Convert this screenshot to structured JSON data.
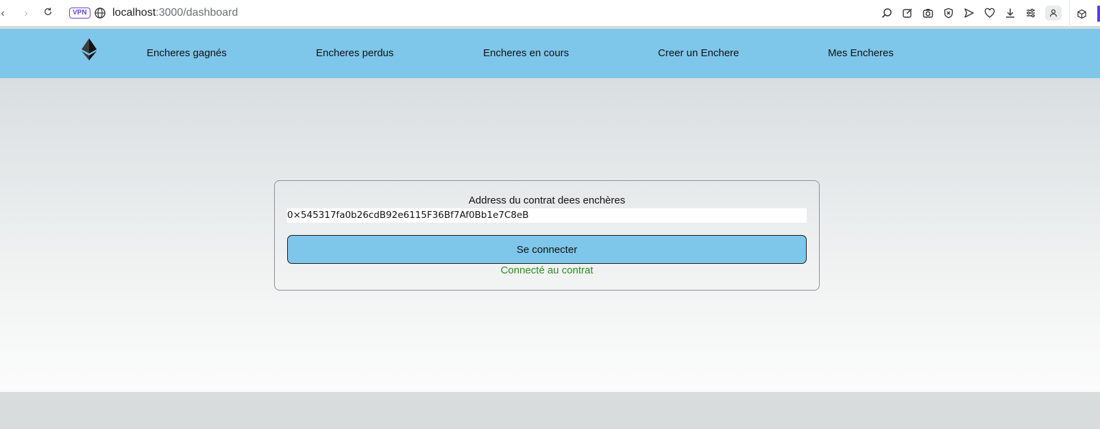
{
  "browser": {
    "vpn_label": "VPN",
    "url_host": "localhost",
    "url_path": ":3000/dashboard",
    "icons": [
      "back-icon",
      "forward-icon",
      "reload-icon",
      "globe-icon",
      "search-icon",
      "edit-icon",
      "camera-icon",
      "shield-icon",
      "send-icon",
      "heart-icon",
      "download-icon",
      "settings-icon",
      "profile-icon",
      "extension-icon"
    ]
  },
  "navbar": {
    "logo_icon": "ethereum-icon",
    "links": [
      "Encheres gagnés",
      "Encheres perdus",
      "Encheres en cours",
      "Creer un Enchere",
      "Mes Encheres"
    ]
  },
  "card": {
    "label": "Address du contrat dees enchères",
    "address_value": "0×545317fa0b26cdB92e6115F36Bf7Af0Bb1e7C8eB",
    "button_label": "Se connecter",
    "status_text": "Connecté au contrat"
  },
  "colors": {
    "navbar_bg": "#7ec6ea",
    "button_bg": "#7ec6ea",
    "status_green": "#2e8b1f",
    "vpn_purple": "#6b3fd6"
  }
}
